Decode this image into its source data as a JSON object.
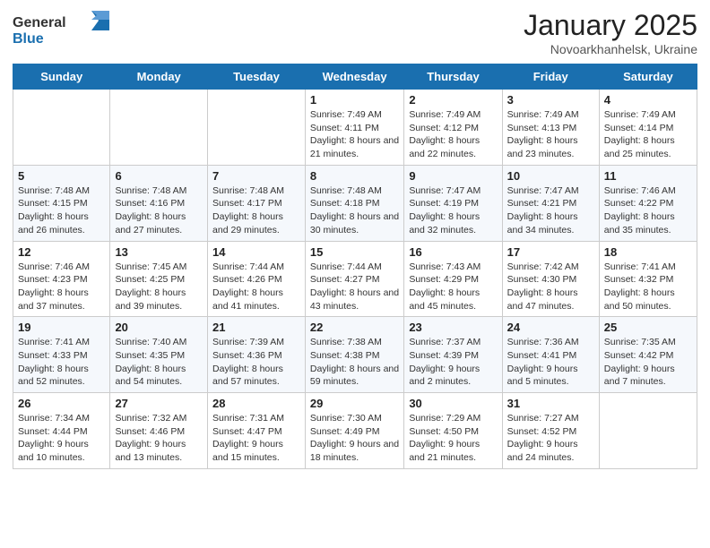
{
  "header": {
    "logo_line1": "General",
    "logo_line2": "Blue",
    "month_title": "January 2025",
    "location": "Novoarkhanhelsk, Ukraine"
  },
  "weekdays": [
    "Sunday",
    "Monday",
    "Tuesday",
    "Wednesday",
    "Thursday",
    "Friday",
    "Saturday"
  ],
  "weeks": [
    [
      {
        "day": "",
        "info": ""
      },
      {
        "day": "",
        "info": ""
      },
      {
        "day": "",
        "info": ""
      },
      {
        "day": "1",
        "info": "Sunrise: 7:49 AM\nSunset: 4:11 PM\nDaylight: 8 hours and 21 minutes."
      },
      {
        "day": "2",
        "info": "Sunrise: 7:49 AM\nSunset: 4:12 PM\nDaylight: 8 hours and 22 minutes."
      },
      {
        "day": "3",
        "info": "Sunrise: 7:49 AM\nSunset: 4:13 PM\nDaylight: 8 hours and 23 minutes."
      },
      {
        "day": "4",
        "info": "Sunrise: 7:49 AM\nSunset: 4:14 PM\nDaylight: 8 hours and 25 minutes."
      }
    ],
    [
      {
        "day": "5",
        "info": "Sunrise: 7:48 AM\nSunset: 4:15 PM\nDaylight: 8 hours and 26 minutes."
      },
      {
        "day": "6",
        "info": "Sunrise: 7:48 AM\nSunset: 4:16 PM\nDaylight: 8 hours and 27 minutes."
      },
      {
        "day": "7",
        "info": "Sunrise: 7:48 AM\nSunset: 4:17 PM\nDaylight: 8 hours and 29 minutes."
      },
      {
        "day": "8",
        "info": "Sunrise: 7:48 AM\nSunset: 4:18 PM\nDaylight: 8 hours and 30 minutes."
      },
      {
        "day": "9",
        "info": "Sunrise: 7:47 AM\nSunset: 4:19 PM\nDaylight: 8 hours and 32 minutes."
      },
      {
        "day": "10",
        "info": "Sunrise: 7:47 AM\nSunset: 4:21 PM\nDaylight: 8 hours and 34 minutes."
      },
      {
        "day": "11",
        "info": "Sunrise: 7:46 AM\nSunset: 4:22 PM\nDaylight: 8 hours and 35 minutes."
      }
    ],
    [
      {
        "day": "12",
        "info": "Sunrise: 7:46 AM\nSunset: 4:23 PM\nDaylight: 8 hours and 37 minutes."
      },
      {
        "day": "13",
        "info": "Sunrise: 7:45 AM\nSunset: 4:25 PM\nDaylight: 8 hours and 39 minutes."
      },
      {
        "day": "14",
        "info": "Sunrise: 7:44 AM\nSunset: 4:26 PM\nDaylight: 8 hours and 41 minutes."
      },
      {
        "day": "15",
        "info": "Sunrise: 7:44 AM\nSunset: 4:27 PM\nDaylight: 8 hours and 43 minutes."
      },
      {
        "day": "16",
        "info": "Sunrise: 7:43 AM\nSunset: 4:29 PM\nDaylight: 8 hours and 45 minutes."
      },
      {
        "day": "17",
        "info": "Sunrise: 7:42 AM\nSunset: 4:30 PM\nDaylight: 8 hours and 47 minutes."
      },
      {
        "day": "18",
        "info": "Sunrise: 7:41 AM\nSunset: 4:32 PM\nDaylight: 8 hours and 50 minutes."
      }
    ],
    [
      {
        "day": "19",
        "info": "Sunrise: 7:41 AM\nSunset: 4:33 PM\nDaylight: 8 hours and 52 minutes."
      },
      {
        "day": "20",
        "info": "Sunrise: 7:40 AM\nSunset: 4:35 PM\nDaylight: 8 hours and 54 minutes."
      },
      {
        "day": "21",
        "info": "Sunrise: 7:39 AM\nSunset: 4:36 PM\nDaylight: 8 hours and 57 minutes."
      },
      {
        "day": "22",
        "info": "Sunrise: 7:38 AM\nSunset: 4:38 PM\nDaylight: 8 hours and 59 minutes."
      },
      {
        "day": "23",
        "info": "Sunrise: 7:37 AM\nSunset: 4:39 PM\nDaylight: 9 hours and 2 minutes."
      },
      {
        "day": "24",
        "info": "Sunrise: 7:36 AM\nSunset: 4:41 PM\nDaylight: 9 hours and 5 minutes."
      },
      {
        "day": "25",
        "info": "Sunrise: 7:35 AM\nSunset: 4:42 PM\nDaylight: 9 hours and 7 minutes."
      }
    ],
    [
      {
        "day": "26",
        "info": "Sunrise: 7:34 AM\nSunset: 4:44 PM\nDaylight: 9 hours and 10 minutes."
      },
      {
        "day": "27",
        "info": "Sunrise: 7:32 AM\nSunset: 4:46 PM\nDaylight: 9 hours and 13 minutes."
      },
      {
        "day": "28",
        "info": "Sunrise: 7:31 AM\nSunset: 4:47 PM\nDaylight: 9 hours and 15 minutes."
      },
      {
        "day": "29",
        "info": "Sunrise: 7:30 AM\nSunset: 4:49 PM\nDaylight: 9 hours and 18 minutes."
      },
      {
        "day": "30",
        "info": "Sunrise: 7:29 AM\nSunset: 4:50 PM\nDaylight: 9 hours and 21 minutes."
      },
      {
        "day": "31",
        "info": "Sunrise: 7:27 AM\nSunset: 4:52 PM\nDaylight: 9 hours and 24 minutes."
      },
      {
        "day": "",
        "info": ""
      }
    ]
  ]
}
